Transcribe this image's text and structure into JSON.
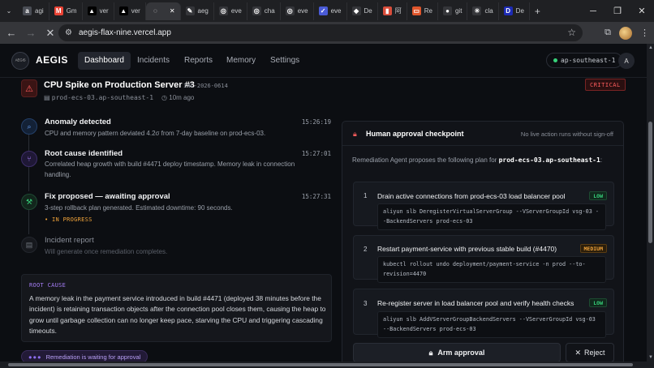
{
  "browser": {
    "tabs": [
      {
        "label": "agi",
        "fav": "a",
        "fav_color": "#4a4d55"
      },
      {
        "label": "Gm",
        "fav": "M",
        "fav_color": "#ea4335"
      },
      {
        "label": "ver",
        "fav": "▲",
        "fav_color": "#000000"
      },
      {
        "label": "ver",
        "fav": "▲",
        "fav_color": "#000000"
      },
      {
        "label": "",
        "fav": "◌",
        "fav_color": "#35363a"
      },
      {
        "label": "aeg",
        "fav": "✎",
        "fav_color": "#35363a"
      },
      {
        "label": "eve",
        "fav": "◎",
        "fav_color": "#35363a"
      },
      {
        "label": "cha",
        "fav": "◎",
        "fav_color": "#35363a"
      },
      {
        "label": "eve",
        "fav": "◎",
        "fav_color": "#35363a"
      },
      {
        "label": "eve",
        "fav": "✓",
        "fav_color": "#4a5bd6"
      },
      {
        "label": "De",
        "fav": "◆",
        "fav_color": "#35363a"
      },
      {
        "label": "阿",
        "fav": "▮",
        "fav_color": "#d94d3b"
      },
      {
        "label": "Re",
        "fav": "▭",
        "fav_color": "#e0562c"
      },
      {
        "label": "git",
        "fav": "●",
        "fav_color": "#35363a"
      },
      {
        "label": "cla",
        "fav": "✳",
        "fav_color": "#35363a"
      },
      {
        "label": "De",
        "fav": "D",
        "fav_color": "#1d2bb5"
      }
    ],
    "new_tab": "+",
    "url": "aegis-flax-nine.vercel.app"
  },
  "app": {
    "brand": "AEGIS",
    "logo_text": "AEGIS",
    "nav": [
      "Dashboard",
      "Incidents",
      "Reports",
      "Memory",
      "Settings"
    ],
    "region": "ap-southeast-1",
    "user_initial": "A"
  },
  "incident": {
    "title": "CPU Spike on Production Server #3",
    "id": "INC-2026-0614",
    "host": "prod-ecs-03.ap-southeast-1",
    "age": "10m ago",
    "severity": "CRITICAL"
  },
  "timeline": [
    {
      "title": "Anomaly detected",
      "desc": "CPU and memory pattern deviated 4.2σ from 7-day baseline on prod-ecs-03.",
      "time": "15:26:19"
    },
    {
      "title": "Root cause identified",
      "desc": "Correlated heap growth with build #4471 deploy timestamp. Memory leak in connection handling.",
      "time": "15:27:01"
    },
    {
      "title": "Fix proposed — awaiting approval",
      "desc": "3-step rollback plan generated. Estimated downtime: 90 seconds.",
      "time": "15:27:31",
      "status": "• IN PROGRESS"
    },
    {
      "title": "Incident report",
      "desc": "Will generate once remediation completes.",
      "time": ""
    }
  ],
  "root_cause": {
    "label": "ROOT CAUSE",
    "text": "A memory leak in the payment service introduced in build #4471 (deployed 38 minutes before the incident) is retaining transaction objects after the connection pool closes them, causing the heap to grow until garbage collection can no longer keep pace, starving the CPU and triggering cascading timeouts."
  },
  "waiting_badge": "Remediation is waiting for approval",
  "approval": {
    "title": "Human approval checkpoint",
    "note": "No live action runs without sign-off",
    "intro_prefix": "Remediation Agent proposes the following plan for",
    "intro_host": "prod-ecs-03.ap-southeast-1",
    "intro_suffix": ":",
    "steps": [
      {
        "num": "1",
        "title": "Drain active connections from prod-ecs-03 load balancer pool",
        "risk": "LOW",
        "cmd": "aliyun slb DeregisterVirtualServerGroup --VServerGroupId vsg-03 --BackendServers prod-ecs-03"
      },
      {
        "num": "2",
        "title": "Restart payment-service with previous stable build (#4470)",
        "risk": "MEDIUM",
        "cmd": "kubectl rollout undo deployment/payment-service -n prod --to-revision=4470"
      },
      {
        "num": "3",
        "title": "Re-register server in load balancer pool and verify health checks",
        "risk": "LOW",
        "cmd": "aliyun slb AddVServerGroupBackendServers --VServerGroupId vsg-03 --BackendServers prod-ecs-03"
      }
    ],
    "arm_label": "Arm approval",
    "reject_label": "Reject"
  }
}
